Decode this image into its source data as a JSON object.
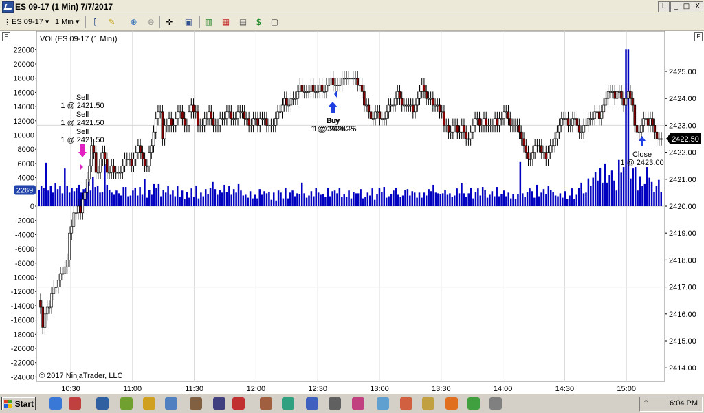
{
  "window": {
    "title": "ES 09-17 (1 Min)  7/7/2017",
    "buttons": [
      "L",
      "_",
      "□",
      "X"
    ]
  },
  "toolbar": {
    "instrument": "ES 09-17",
    "interval": "1 Min"
  },
  "panel_label": "F",
  "indicator_label": "VOL(ES 09-17 (1 Min))",
  "copyright": "© 2017 NinjaTrader, LLC",
  "colors": {
    "volume": "#0000c0",
    "up_candle": "#ffffff",
    "down_candle": "#8b0000",
    "grid": "#d8d8d8",
    "buy_marker": "#1f3fe0",
    "sell_marker": "#e020c0",
    "price_tag": "#000000",
    "volume_tag": "#2244aa"
  },
  "chart_data": [
    {
      "type": "bar",
      "name": "volume",
      "y_axis_ticks": [
        "22000",
        "20000",
        "18000",
        "16000",
        "14000",
        "12000",
        "10000",
        "8000",
        "6000",
        "4000",
        "2000",
        "0",
        "-2000",
        "-4000",
        "-6000",
        "-8000",
        "-10000",
        "-12000",
        "-14000",
        "-16000",
        "-18000",
        "-20000",
        "-22000",
        "-24000"
      ],
      "ylim": [
        -24000,
        22000
      ],
      "current_value_label": "2269",
      "values": [
        2300,
        2900,
        2600,
        6100,
        2200,
        2900,
        1900,
        3200,
        2400,
        2900,
        1800,
        5300,
        2900,
        1900,
        2600,
        2100,
        2600,
        3000,
        1900,
        2400,
        2600,
        3400,
        2200,
        4100,
        2700,
        2800,
        1900,
        2000,
        5900,
        3000,
        2300,
        1900,
        1600,
        2200,
        1800,
        1500,
        2700,
        2700,
        1400,
        1500,
        2200,
        2600,
        1500,
        2700,
        1600,
        3800,
        1200,
        2300,
        1600,
        3100,
        2600,
        3100,
        1400,
        2300,
        1900,
        2900,
        1600,
        2200,
        1400,
        2800,
        1300,
        2200,
        1000,
        2000,
        1200,
        2500,
        1300,
        2900,
        1100,
        1900,
        1400,
        2400,
        1700,
        2600,
        3400,
        2400,
        1600,
        2300,
        1900,
        3000,
        2000,
        2800,
        1600,
        2400,
        1900,
        3100,
        2200,
        1500,
        1600,
        1200,
        2100,
        1100,
        1600,
        1100,
        2400,
        1600,
        2100,
        1800,
        2000,
        900,
        1900,
        800,
        2200,
        1900,
        1100,
        2600,
        1100,
        1900,
        2200,
        1400,
        1800,
        1700,
        3300,
        1800,
        1200,
        1500,
        2100,
        1400,
        2600,
        1900,
        1600,
        1700,
        1300,
        2600,
        1400,
        2100,
        2200,
        1800,
        2600,
        1300,
        1700,
        1300,
        2200,
        1100,
        2000,
        1800,
        1800,
        2400,
        1100,
        1300,
        1900,
        1500,
        2500,
        900,
        1700,
        2600,
        2000,
        2700,
        1200,
        1400,
        1700,
        2200,
        2600,
        1600,
        1300,
        1500,
        2300,
        2400,
        1500,
        2100,
        1900,
        1200,
        1900,
        1200,
        1900,
        1500,
        2400,
        2100,
        3000,
        1900,
        1800,
        1700,
        1800,
        2300,
        1600,
        1800,
        1300,
        1500,
        2500,
        1800,
        3200,
        1800,
        1300,
        1800,
        2600,
        1100,
        2000,
        2500,
        1500,
        2700,
        2300,
        1200,
        1600,
        2100,
        1400,
        2700,
        1400,
        1700,
        2200,
        1400,
        1900,
        1100,
        1700,
        1000,
        1700,
        6200,
        1800,
        1300,
        2000,
        2500,
        2100,
        1200,
        3000,
        1400,
        1900,
        2400,
        1700,
        2800,
        2300,
        2000,
        1500,
        1400,
        1800,
        1200,
        2100,
        1000,
        1500,
        2500,
        1000,
        1600,
        2600,
        3300,
        1800,
        1900,
        3900,
        2900,
        4000,
        4800,
        3600,
        5400,
        3300,
        6000,
        3300,
        4400,
        5000,
        3600,
        2200,
        6500,
        4700,
        5500,
        22000,
        22000,
        3900,
        5300,
        5500,
        2200,
        4200,
        2800,
        3100,
        5500,
        4000,
        3400,
        2000,
        2800,
        3700,
        2000
      ]
    },
    {
      "type": "candlestick",
      "name": "ES 09-17 (1 Min)",
      "x_axis_ticks": [
        "10:30",
        "11:00",
        "11:30",
        "12:00",
        "12:30",
        "13:00",
        "13:30",
        "14:00",
        "14:30",
        "15:00"
      ],
      "y_axis_ticks": [
        "2425.00",
        "2424.00",
        "2423.00",
        "2422.00",
        "2421.00",
        "2420.00",
        "2419.00",
        "2418.00",
        "2417.00",
        "2416.00",
        "2415.00",
        "2414.00"
      ],
      "ylim": [
        2413.78,
        2425.98
      ],
      "last_price_label": "2422.50",
      "close": [
        2416.25,
        2415.5,
        2416.0,
        2416.25,
        2416.25,
        2416.75,
        2417.0,
        2417.0,
        2417.25,
        2417.5,
        2417.5,
        2417.75,
        2418.0,
        2419.0,
        2419.25,
        2419.75,
        2419.75,
        2420.0,
        2419.75,
        2420.25,
        2420.5,
        2421.0,
        2421.5,
        2422.25,
        2422.0,
        2421.25,
        2421.25,
        2421.75,
        2422.0,
        2421.75,
        2421.25,
        2421.25,
        2421.5,
        2421.25,
        2421.25,
        2421.25,
        2421.25,
        2421.5,
        2421.75,
        2421.75,
        2421.75,
        2421.5,
        2421.75,
        2422.0,
        2422.25,
        2422.0,
        2421.75,
        2421.5,
        2421.5,
        2422.0,
        2422.25,
        2422.75,
        2423.25,
        2423.5,
        2423.5,
        2422.5,
        2423.0,
        2423.0,
        2423.25,
        2423.0,
        2423.0,
        2423.25,
        2423.5,
        2423.5,
        2423.25,
        2423.0,
        2423.0,
        2423.5,
        2423.75,
        2423.5,
        2423.5,
        2423.0,
        2423.0,
        2423.0,
        2423.25,
        2423.25,
        2423.5,
        2423.25,
        2423.0,
        2423.0,
        2423.0,
        2423.25,
        2423.25,
        2423.25,
        2423.5,
        2423.5,
        2423.25,
        2423.25,
        2423.25,
        2423.5,
        2423.5,
        2423.5,
        2423.25,
        2423.25,
        2423.0,
        2423.0,
        2423.25,
        2423.25,
        2423.0,
        2423.25,
        2423.25,
        2423.25,
        2423.0,
        2423.0,
        2423.0,
        2423.0,
        2423.25,
        2423.5,
        2423.5,
        2423.75,
        2424.0,
        2423.75,
        2423.75,
        2424.0,
        2424.0,
        2424.0,
        2424.25,
        2424.5,
        2424.25,
        2424.25,
        2424.25,
        2424.25,
        2424.5,
        2424.25,
        2424.25,
        2424.25,
        2424.5,
        2424.25,
        2424.25,
        2424.5,
        2424.5,
        2424.75,
        2424.5,
        2424.5,
        2424.5,
        2424.5,
        2424.75,
        2424.75,
        2424.75,
        2424.75,
        2424.75,
        2424.75,
        2424.75,
        2424.5,
        2424.5,
        2424.25,
        2423.75,
        2423.75,
        2423.5,
        2423.25,
        2423.25,
        2423.5,
        2423.5,
        2423.25,
        2423.25,
        2423.25,
        2423.5,
        2423.75,
        2423.75,
        2423.75,
        2424.0,
        2424.25,
        2424.0,
        2423.75,
        2423.75,
        2423.75,
        2423.75,
        2423.75,
        2423.5,
        2423.75,
        2424.0,
        2424.25,
        2424.5,
        2424.25,
        2424.0,
        2424.0,
        2424.0,
        2423.75,
        2423.75,
        2423.75,
        2423.5,
        2423.5,
        2423.0,
        2423.0,
        2422.75,
        2422.75,
        2423.0,
        2423.0,
        2422.75,
        2422.75,
        2423.0,
        2422.75,
        2422.5,
        2422.5,
        2422.75,
        2423.0,
        2423.25,
        2423.25,
        2423.0,
        2423.0,
        2423.25,
        2423.0,
        2423.0,
        2423.0,
        2423.0,
        2423.25,
        2423.0,
        2423.25,
        2423.25,
        2423.5,
        2423.5,
        2423.25,
        2423.0,
        2423.0,
        2423.0,
        2423.0,
        2422.75,
        2422.5,
        2422.25,
        2422.0,
        2421.75,
        2421.75,
        2422.0,
        2422.25,
        2422.25,
        2422.25,
        2422.0,
        2422.0,
        2421.75,
        2422.0,
        2422.25,
        2422.25,
        2422.5,
        2422.75,
        2423.0,
        2423.25,
        2423.25,
        2423.25,
        2423.0,
        2423.0,
        2423.25,
        2423.25,
        2423.0,
        2422.75,
        2422.75,
        2423.0,
        2423.0,
        2423.25,
        2423.25,
        2423.25,
        2423.5,
        2423.5,
        2423.25,
        2423.5,
        2423.75,
        2424.0,
        2424.25,
        2424.25,
        2424.25,
        2424.0,
        2424.25,
        2424.25,
        2424.0,
        2423.75,
        2424.0,
        2424.25,
        2424.0,
        2423.75,
        2423.0,
        2422.75,
        2422.75,
        2423.0,
        2423.25,
        2423.25,
        2423.0,
        2423.25,
        2423.0,
        2422.75,
        2422.5,
        2422.5,
        2422.5
      ]
    }
  ],
  "trades": [
    {
      "action": "Sell",
      "detail": "1 @ 2421.50"
    },
    {
      "action": "Sell",
      "detail": "1 @ 2421.50"
    },
    {
      "action": "Sell",
      "detail": "1 @ 2421.50"
    },
    {
      "action": "Buy",
      "detail": "1 @ 2424.25"
    },
    {
      "action": "Buy",
      "detail": "1 @ 2424.25"
    },
    {
      "action": "Close",
      "detail": "1 @ 2423.00"
    }
  ],
  "taskbar": {
    "start_label": "Start",
    "clock": "6:04 PM"
  }
}
